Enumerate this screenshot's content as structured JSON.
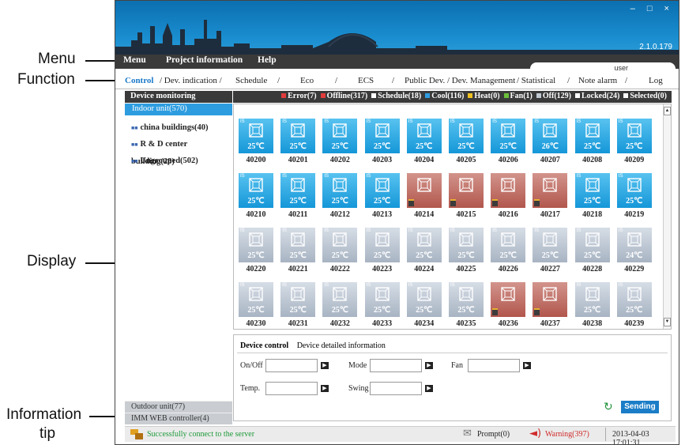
{
  "annotations": {
    "menu": "Menu",
    "function": "Function",
    "display": "Display",
    "info_line1": "Information",
    "info_line2": "tip"
  },
  "window": {
    "controls": "– □ ×",
    "version": "2.1.0.179"
  },
  "menu": {
    "items": [
      "Menu",
      "Project information",
      "Help"
    ],
    "user": "user"
  },
  "function_bar": [
    "Control",
    "/ Dev. indication /",
    "Schedule",
    "/",
    "Eco",
    "/",
    "ECS",
    "/",
    "Public Dev.",
    "/ Dev. Management",
    "/ Statistical",
    "/",
    "Note alarm",
    "/",
    "Log"
  ],
  "left_panel": {
    "header": "Device monitoring",
    "indoor": "Indoor unit(570)",
    "groups": [
      "china buildings(40)",
      "R & D center building(28)",
      "Ungrouped(502)"
    ],
    "outdoor": "Outdoor unit(77)",
    "imm": "IMM WEB controller(4)"
  },
  "legend": {
    "items": [
      {
        "label": "Error(7)",
        "color": "#e23c3c"
      },
      {
        "label": "Offline(317)",
        "color": "#e23c3c"
      },
      {
        "label": "Schedule(18)",
        "color": "#ffffff"
      },
      {
        "label": "Cool(116)",
        "color": "#2e9de0"
      },
      {
        "label": "Heat(0)",
        "color": "#f0c020"
      },
      {
        "label": "Fan(1)",
        "color": "#6bbf3a"
      },
      {
        "label": "Off(129)",
        "color": "#c0c8d2"
      },
      {
        "label": "Locked(24)",
        "color": "#ffffff"
      },
      {
        "label": "Selected(0)",
        "color": "#ffffff"
      }
    ]
  },
  "units": [
    {
      "id": "40200",
      "state": "cool",
      "temp": "25℃"
    },
    {
      "id": "40201",
      "state": "cool",
      "temp": "25℃"
    },
    {
      "id": "40202",
      "state": "cool",
      "temp": "25℃"
    },
    {
      "id": "40203",
      "state": "cool",
      "temp": "25℃"
    },
    {
      "id": "40204",
      "state": "cool",
      "temp": "25℃"
    },
    {
      "id": "40205",
      "state": "cool",
      "temp": "25℃"
    },
    {
      "id": "40206",
      "state": "cool",
      "temp": "25℃"
    },
    {
      "id": "40207",
      "state": "cool",
      "temp": "26℃"
    },
    {
      "id": "40208",
      "state": "cool",
      "temp": "25℃"
    },
    {
      "id": "40209",
      "state": "cool",
      "temp": "25℃"
    },
    {
      "id": "40210",
      "state": "cool",
      "temp": "25℃"
    },
    {
      "id": "40211",
      "state": "cool",
      "temp": "25℃"
    },
    {
      "id": "40212",
      "state": "cool",
      "temp": "25℃"
    },
    {
      "id": "40213",
      "state": "cool",
      "temp": "25℃"
    },
    {
      "id": "40214",
      "state": "error",
      "temp": ""
    },
    {
      "id": "40215",
      "state": "error",
      "temp": ""
    },
    {
      "id": "40216",
      "state": "error",
      "temp": ""
    },
    {
      "id": "40217",
      "state": "error",
      "temp": ""
    },
    {
      "id": "40218",
      "state": "cool",
      "temp": "25℃"
    },
    {
      "id": "40219",
      "state": "cool",
      "temp": "25℃"
    },
    {
      "id": "40220",
      "state": "off",
      "temp": "25℃"
    },
    {
      "id": "40221",
      "state": "off",
      "temp": "25℃"
    },
    {
      "id": "40222",
      "state": "off",
      "temp": "25℃"
    },
    {
      "id": "40223",
      "state": "off",
      "temp": "25℃"
    },
    {
      "id": "40224",
      "state": "off",
      "temp": "25℃"
    },
    {
      "id": "40225",
      "state": "off",
      "temp": "25℃"
    },
    {
      "id": "40226",
      "state": "off",
      "temp": "25℃"
    },
    {
      "id": "40227",
      "state": "off",
      "temp": "25℃"
    },
    {
      "id": "40228",
      "state": "off",
      "temp": "25℃"
    },
    {
      "id": "40229",
      "state": "off",
      "temp": "24℃"
    },
    {
      "id": "40230",
      "state": "off",
      "temp": "25℃"
    },
    {
      "id": "40231",
      "state": "off",
      "temp": "25℃"
    },
    {
      "id": "40232",
      "state": "off",
      "temp": "25℃"
    },
    {
      "id": "40233",
      "state": "off",
      "temp": "25℃"
    },
    {
      "id": "40234",
      "state": "off",
      "temp": "25℃"
    },
    {
      "id": "40235",
      "state": "off",
      "temp": "25℃"
    },
    {
      "id": "40236",
      "state": "error",
      "temp": ""
    },
    {
      "id": "40237",
      "state": "error",
      "temp": ""
    },
    {
      "id": "40238",
      "state": "off",
      "temp": "25℃"
    },
    {
      "id": "40239",
      "state": "off",
      "temp": "25℃"
    }
  ],
  "control": {
    "tab_active": "Device control",
    "tab_other": "Device detailed information",
    "labels": {
      "onoff": "On/Off",
      "mode": "Mode",
      "fan": "Fan",
      "temp": "Temp.",
      "swing": "Swing"
    },
    "send": "Sending"
  },
  "status": {
    "message": "Successfully connect to the server",
    "prompt": "Prompt(0)",
    "warning": "Warning(397)",
    "datetime": "2013-04-03 17:01:31"
  }
}
